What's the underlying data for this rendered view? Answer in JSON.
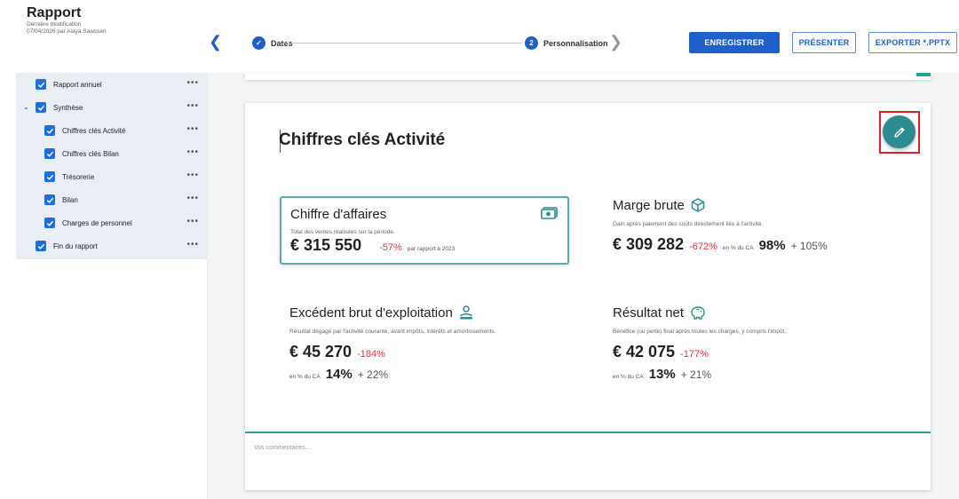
{
  "header": {
    "title": "Rapport",
    "meta_line1": "Dernière modification",
    "meta_line2": "07/04/2026 par Alaya Sawssen",
    "steps": [
      {
        "label": "Dates",
        "badge": "✓"
      },
      {
        "label": "Personnalisation",
        "badge": "2"
      }
    ],
    "buttons": {
      "save": "ENREGISTRER",
      "present": "PRÉSENTER",
      "export": "EXPORTER *.PPTX"
    }
  },
  "sidebar": {
    "items": [
      {
        "label": "Rapport annuel",
        "dots": "•••"
      },
      {
        "label": "Synthèse",
        "dots": "•••"
      },
      {
        "label": "Chiffres clés Activité",
        "dots": "•••"
      },
      {
        "label": "Chiffres clés Bilan",
        "dots": "•••"
      },
      {
        "label": "Trésorerie",
        "dots": "•••"
      },
      {
        "label": "Bilan",
        "dots": "•••"
      },
      {
        "label": "Charges de personnel",
        "dots": "•••"
      },
      {
        "label": "Fin du rapport",
        "dots": "•••"
      }
    ]
  },
  "main": {
    "title": "Chiffres clés Activité",
    "kpis": [
      {
        "title": "Chiffre d'affaires",
        "desc": "Total des ventes réalisées sur la période.",
        "value": "€ 315 550",
        "change": "-57%",
        "compare": "par rapport à 2023"
      },
      {
        "title": "Marge brute",
        "desc": "Gain après paiement des coûts directement liés à l'activité.",
        "value": "€ 309 282",
        "change": "-672%",
        "pct_label": "en % du CA",
        "pct_value": "98%",
        "pct_change": "+ 105%"
      },
      {
        "title": "Excédent brut d'exploitation",
        "desc": "Résultat dégagé par l'activité courante, avant impôts, intérêts et amortissements.",
        "value": "€ 45 270",
        "change": "-184%",
        "pct_label": "en % du CA",
        "pct_value": "14%",
        "pct_change": "+ 22%"
      },
      {
        "title": "Résultat net",
        "desc": "Bénéfice (ou perte) final après toutes les charges, y compris l'impôt.",
        "value": "€ 42 075",
        "change": "-177%",
        "pct_label": "en % du CA",
        "pct_value": "13%",
        "pct_change": "+ 21%"
      }
    ],
    "comments_placeholder": "Vos commentaires..."
  },
  "colors": {
    "primary": "#1f5fc9",
    "teal": "#2b8c91",
    "negative": "#e0343a",
    "highlight": "#e11f2b"
  }
}
